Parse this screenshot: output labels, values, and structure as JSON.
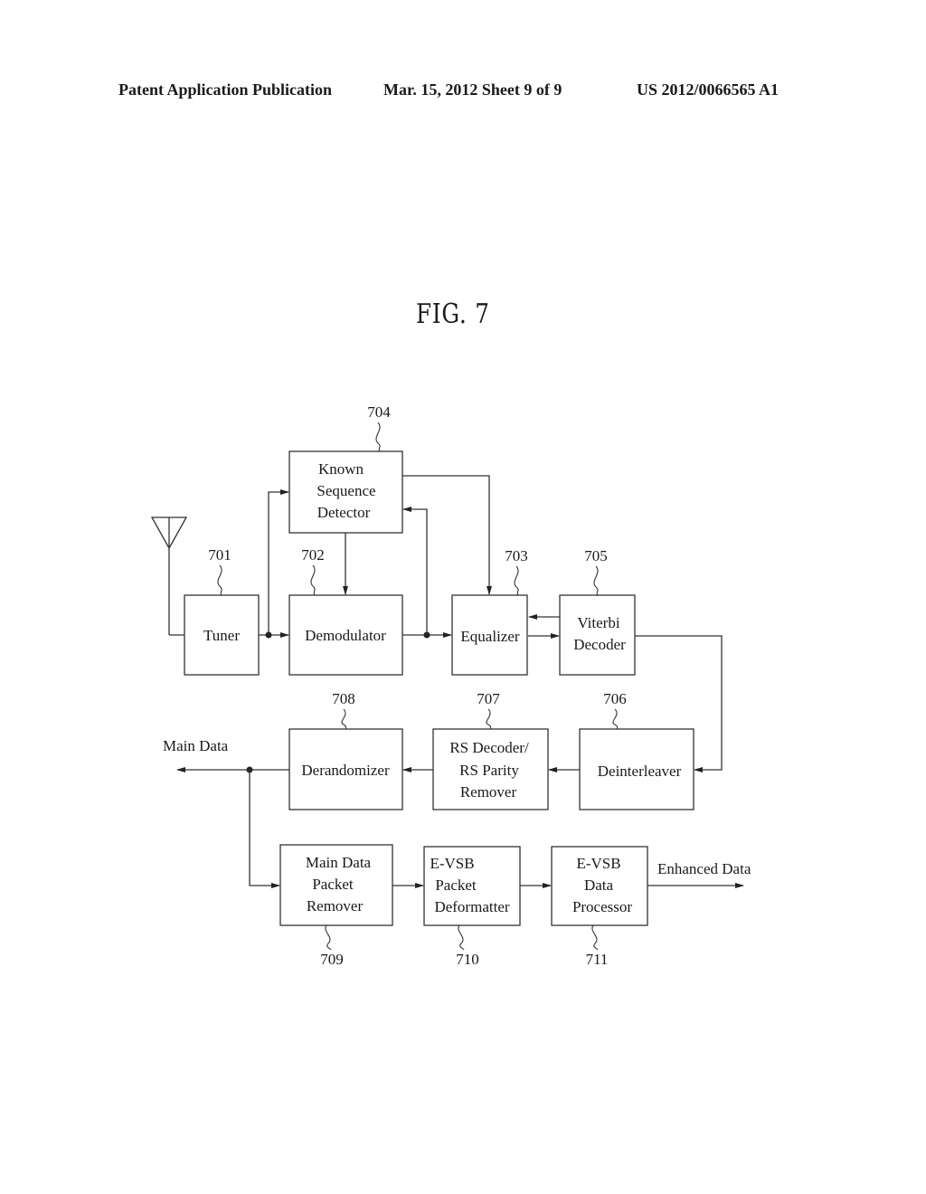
{
  "header": {
    "left": "Patent Application Publication",
    "middle": "Mar. 15, 2012  Sheet 9 of 9",
    "right": "US 2012/0066565 A1"
  },
  "figure": {
    "title": "FIG. 7",
    "blocks": [
      {
        "id": "701",
        "lines": [
          "Tuner"
        ]
      },
      {
        "id": "702",
        "lines": [
          "Demodulator"
        ]
      },
      {
        "id": "703",
        "lines": [
          "Equalizer"
        ]
      },
      {
        "id": "704",
        "lines": [
          "Known",
          "Sequence",
          "Detector"
        ]
      },
      {
        "id": "705",
        "lines": [
          "Viterbi",
          "Decoder"
        ]
      },
      {
        "id": "706",
        "lines": [
          "Deinterleaver"
        ]
      },
      {
        "id": "707",
        "lines": [
          "RS Decoder/",
          "RS Parity",
          "Remover"
        ]
      },
      {
        "id": "708",
        "lines": [
          "Derandomizer"
        ]
      },
      {
        "id": "709",
        "lines": [
          "Main Data",
          "Packet",
          "Remover"
        ]
      },
      {
        "id": "710",
        "lines": [
          "E-VSB",
          "Packet",
          "Deformatter"
        ]
      },
      {
        "id": "711",
        "lines": [
          "E-VSB",
          "Data",
          "Processor"
        ]
      }
    ],
    "outputs": {
      "main_data": "Main Data",
      "enhanced_data": "Enhanced Data"
    },
    "icons": {
      "antenna": "antenna-icon"
    }
  }
}
